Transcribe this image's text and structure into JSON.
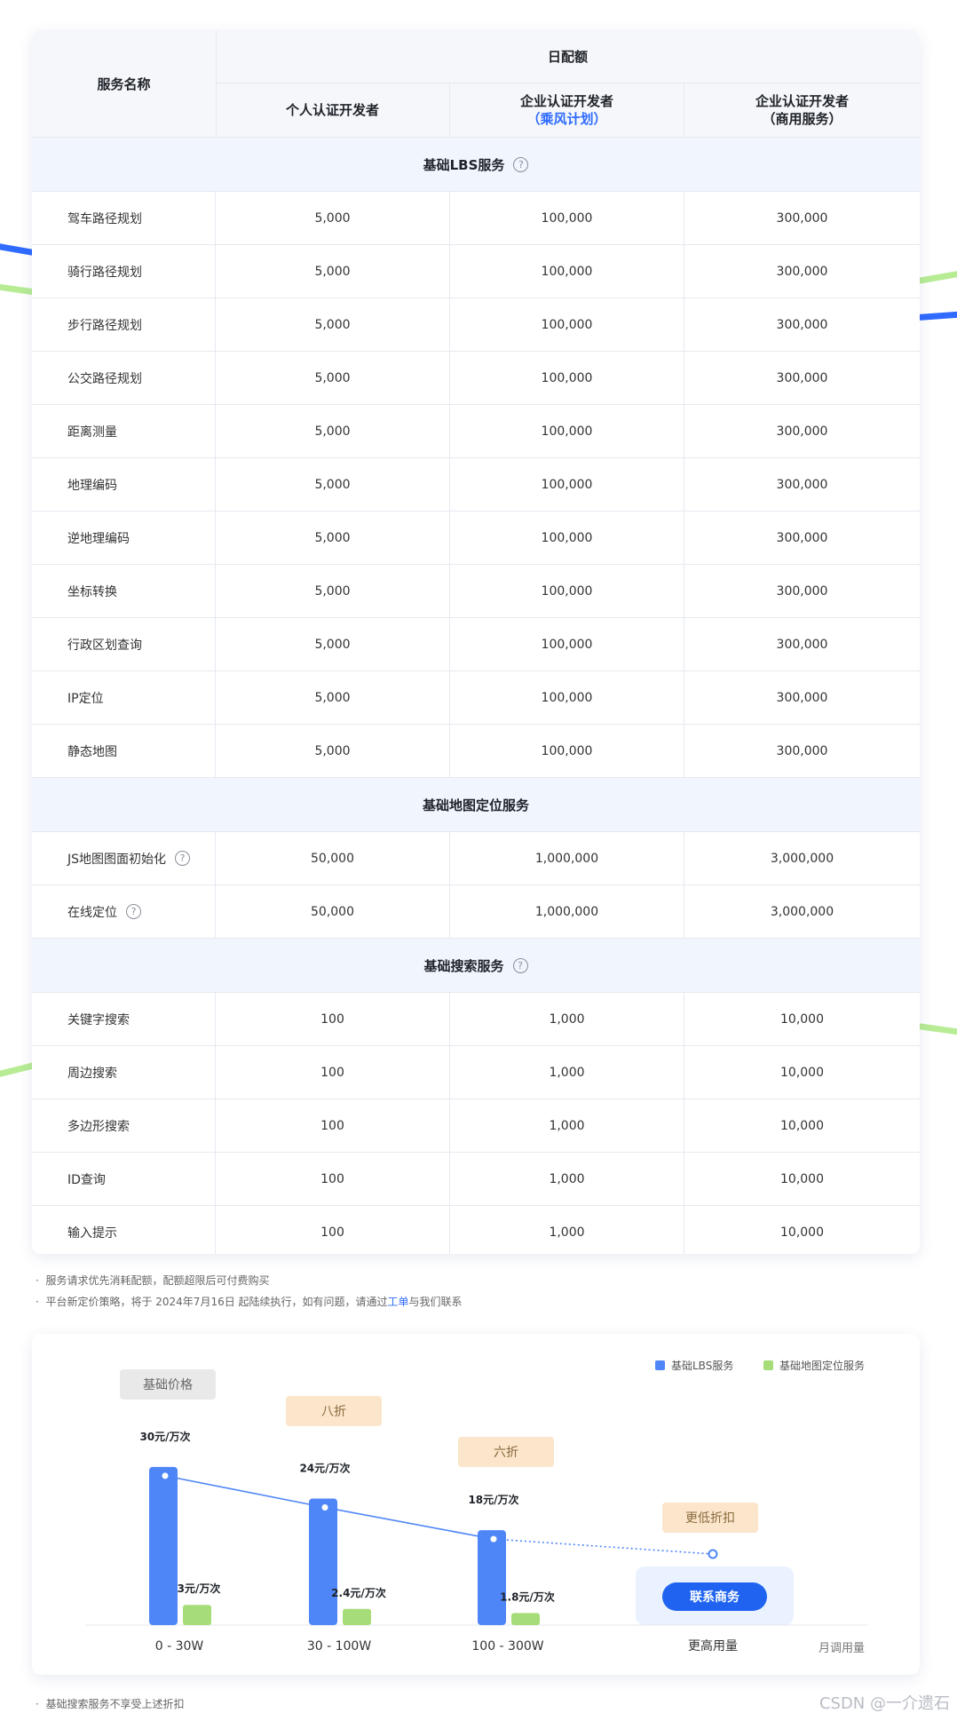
{
  "colors": {
    "accent": "#2f6bff",
    "lbs": "#4f86f7",
    "location": "#a6dd78"
  },
  "table": {
    "header": {
      "service_name": "服务名称",
      "daily_quota": "日配额",
      "col_personal": "个人认证开发者",
      "col_enterprise": "企业认证开发者",
      "col_enterprise_sub": "（乘风计划）",
      "col_commercial": "企业认证开发者",
      "col_commercial_sub": "（商用服务）"
    },
    "sections": [
      {
        "title": "基础LBS服务",
        "rows": [
          {
            "name": "驾车路径规划",
            "values": [
              "5,000",
              "100,000",
              "300,000"
            ]
          },
          {
            "name": "骑行路径规划",
            "values": [
              "5,000",
              "100,000",
              "300,000"
            ]
          },
          {
            "name": "步行路径规划",
            "values": [
              "5,000",
              "100,000",
              "300,000"
            ]
          },
          {
            "name": "公交路径规划",
            "values": [
              "5,000",
              "100,000",
              "300,000"
            ]
          },
          {
            "name": "距离测量",
            "values": [
              "5,000",
              "100,000",
              "300,000"
            ]
          },
          {
            "name": "地理编码",
            "values": [
              "5,000",
              "100,000",
              "300,000"
            ]
          },
          {
            "name": "逆地理编码",
            "values": [
              "5,000",
              "100,000",
              "300,000"
            ]
          },
          {
            "name": "坐标转换",
            "values": [
              "5,000",
              "100,000",
              "300,000"
            ]
          },
          {
            "name": "行政区划查询",
            "values": [
              "5,000",
              "100,000",
              "300,000"
            ]
          },
          {
            "name": "IP定位",
            "values": [
              "5,000",
              "100,000",
              "300,000"
            ]
          },
          {
            "name": "静态地图",
            "values": [
              "5,000",
              "100,000",
              "300,000"
            ]
          }
        ]
      },
      {
        "title": "基础地图定位服务",
        "rows": [
          {
            "name": "JS地图图面初始化",
            "values": [
              "50,000",
              "1,000,000",
              "3,000,000"
            ]
          },
          {
            "name": "在线定位",
            "values": [
              "50,000",
              "1,000,000",
              "3,000,000"
            ]
          }
        ]
      },
      {
        "title": "基础搜索服务",
        "rows": [
          {
            "name": "关键字搜索",
            "values": [
              "100",
              "1,000",
              "10,000"
            ]
          },
          {
            "name": "周边搜索",
            "values": [
              "100",
              "1,000",
              "10,000"
            ]
          },
          {
            "name": "多边形搜索",
            "values": [
              "100",
              "1,000",
              "10,000"
            ]
          },
          {
            "name": "ID查询",
            "values": [
              "100",
              "1,000",
              "10,000"
            ]
          },
          {
            "name": "输入提示",
            "values": [
              "100",
              "1,000",
              "10,000"
            ]
          }
        ]
      }
    ]
  },
  "notes": {
    "note1": "服务请求优先消耗配额，配额超限后可付费购买",
    "note2_prefix": "平台新定价策略，将于 2024年7月16日 起陆续执行，如有问题，请通过",
    "note2_link": "工单",
    "note2_suffix": "与我们联系"
  },
  "chart_data": {
    "type": "bar",
    "categories": [
      "0 - 30W",
      "30 - 100W",
      "100 - 300W",
      "更高用量"
    ],
    "xlabel": "月调用量",
    "series": [
      {
        "name": "基础LBS服务",
        "values": [
          30,
          24,
          18
        ],
        "labels": [
          "30元/万次",
          "24元/万次",
          "18元/万次"
        ]
      },
      {
        "name": "基础地图定位服务",
        "values": [
          3,
          2.4,
          1.8
        ],
        "labels": [
          "3元/万次",
          "2.4元/万次",
          "1.8元/万次"
        ]
      }
    ],
    "ylim": [
      0,
      32
    ],
    "legend": "top-right",
    "grid": false,
    "tier_tags": [
      "基础价格",
      "八折",
      "六折",
      "更低折扣"
    ],
    "contact_button": "联系商务"
  },
  "footer_note": "基础搜索服务不享受上述折扣",
  "watermark": "CSDN @一介遗石"
}
